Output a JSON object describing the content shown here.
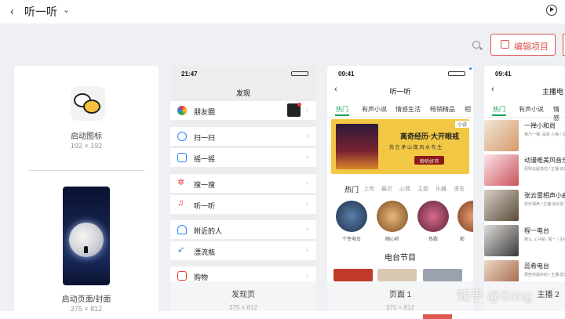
{
  "header": {
    "title": "听一听"
  },
  "toolbar": {
    "edit_label": "编辑项目"
  },
  "colors": {
    "accent": "#d9534f",
    "tab_active": "#1aa35a",
    "banner": "#f2c744"
  },
  "card1": {
    "icon_label": "启动图标",
    "icon_size": "192 × 192",
    "splash_label": "启动页面/封面",
    "splash_size": "375 × 812"
  },
  "card2": {
    "time": "21:47",
    "title": "发现",
    "items": [
      {
        "label": "朋友圈",
        "icon": "moments-icon"
      },
      {
        "label": "扫一扫",
        "icon": "scan-icon"
      },
      {
        "label": "摇一摇",
        "icon": "shake-icon"
      },
      {
        "label": "搜一搜",
        "icon": "search-icon"
      },
      {
        "label": "听一听",
        "icon": "music-icon"
      },
      {
        "label": "附近的人",
        "icon": "nearby-icon"
      },
      {
        "label": "漂流瓶",
        "icon": "bottle-icon"
      },
      {
        "label": "购物",
        "icon": "shopping-icon"
      }
    ],
    "footer": "发现页",
    "footer_size": "375 × 812"
  },
  "card3": {
    "time": "09:41",
    "title": "听一听",
    "tabs": [
      "热门",
      "有声小说",
      "情感生活",
      "畅销精品",
      "相"
    ],
    "banner": {
      "title": "离奇经历·大开眼戒",
      "subtitle": "我 在 茅 山 做 风 水 先 生",
      "button": "聆听好书",
      "tag": "小说"
    },
    "cats": [
      "热门",
      "上传",
      "最近",
      "心情",
      "主题",
      "乐器",
      "语言"
    ],
    "circles": [
      "个性电台",
      "随心听",
      "热歌",
      "影"
    ],
    "section": "电台节目",
    "footer": "页面 1",
    "footer_size": "375 × 812"
  },
  "card4": {
    "time": "09:41",
    "title": "主播电",
    "tabs": [
      "热门",
      "有声小说",
      "情感"
    ],
    "items": [
      {
        "title": "一禅小和尚",
        "desc": "我乃一禅, 是高 小禅 / 主播:一禅小和"
      },
      {
        "title": "动漫唯美风音乐",
        "desc": "风吹云起落花 / 主播:动漫唯美风"
      },
      {
        "title": "张云雷相声小曲",
        "desc": "欢乐相声 / 主播:张云雷"
      },
      {
        "title": "程一电台",
        "desc": "那么, 心中的, 程一 / 主播:程一电台"
      },
      {
        "title": "蕊希电台",
        "desc": "那些你最好的 / 主播:蕊希"
      }
    ],
    "footer": "主播 2"
  },
  "watermark": "知乎 @Song"
}
